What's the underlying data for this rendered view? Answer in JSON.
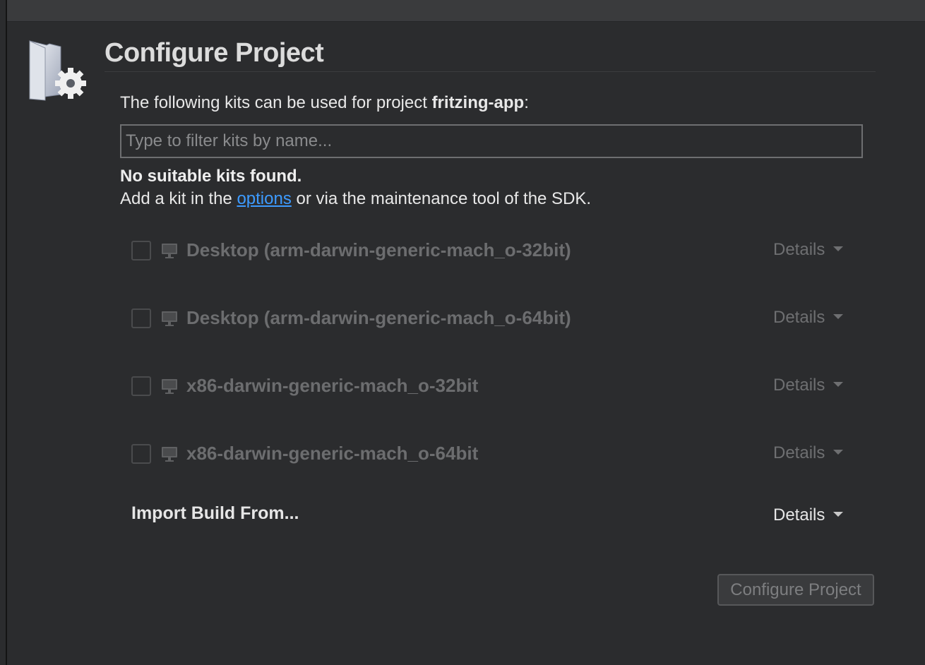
{
  "page": {
    "title": "Configure Project",
    "intro_prefix": "The following kits can be used for project ",
    "project_name": "fritzing-app",
    "intro_suffix": ":"
  },
  "filter": {
    "placeholder": "Type to filter kits by name..."
  },
  "message": {
    "no_kits": "No suitable kits found.",
    "add_prefix": "Add a kit in the ",
    "options_link": "options",
    "add_suffix": " or via the maintenance tool of the SDK."
  },
  "kits": [
    {
      "label": "Desktop (arm-darwin-generic-mach_o-32bit)",
      "details": "Details",
      "checked": false,
      "enabled": false
    },
    {
      "label": "Desktop (arm-darwin-generic-mach_o-64bit)",
      "details": "Details",
      "checked": false,
      "enabled": false
    },
    {
      "label": "x86-darwin-generic-mach_o-32bit",
      "details": "Details",
      "checked": false,
      "enabled": false
    },
    {
      "label": "x86-darwin-generic-mach_o-64bit",
      "details": "Details",
      "checked": false,
      "enabled": false
    }
  ],
  "import_build": {
    "label": "Import Build From...",
    "details": "Details"
  },
  "configure_button": {
    "label": "Configure Project",
    "enabled": false
  },
  "icons": {
    "project": "folder-gear-icon",
    "kit": "monitor-icon",
    "details": "caret-down-icon"
  },
  "colors": {
    "background": "#2b2c2e",
    "link": "#3d9bff",
    "disabled_text": "#6c6d6f"
  }
}
